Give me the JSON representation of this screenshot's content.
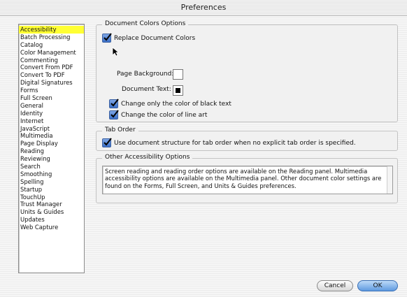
{
  "window": {
    "title": "Preferences"
  },
  "sidebar": {
    "selected": "Accessibility",
    "items": [
      "Accessibility",
      "Batch Processing",
      "Catalog",
      "Color Management",
      "Commenting",
      "Convert From PDF",
      "Convert To PDF",
      "Digital Signatures",
      "Forms",
      "Full Screen",
      "General",
      "Identity",
      "Internet",
      "JavaScript",
      "Multimedia",
      "Page Display",
      "Reading",
      "Reviewing",
      "Search",
      "Smoothing",
      "Spelling",
      "Startup",
      "TouchUp",
      "Trust Manager",
      "Units & Guides",
      "Updates",
      "Web Capture"
    ]
  },
  "document_colors": {
    "legend": "Document Colors Options",
    "replace_label": "Replace Document Colors",
    "replace_checked": true,
    "page_background_label": "Page Background:",
    "page_background_color": "#ffffff",
    "document_text_label": "Document Text:",
    "document_text_color": "#000000",
    "change_black_text_label": "Change only the color of black text",
    "change_black_text_checked": true,
    "change_line_art_label": "Change the color of line art",
    "change_line_art_checked": true
  },
  "tab_order": {
    "legend": "Tab Order",
    "use_structure_label": "Use document structure for tab order when no explicit tab order is specified.",
    "use_structure_checked": true
  },
  "other_options": {
    "legend": "Other Accessibility Options",
    "info_text": "Screen reading and reading order options are available on the Reading panel. Multimedia accessibility options are available on the Multimedia panel. Other document color settings are found on the Forms, Full Screen, and Units & Guides preferences."
  },
  "buttons": {
    "cancel_label": "Cancel",
    "ok_label": "OK"
  }
}
